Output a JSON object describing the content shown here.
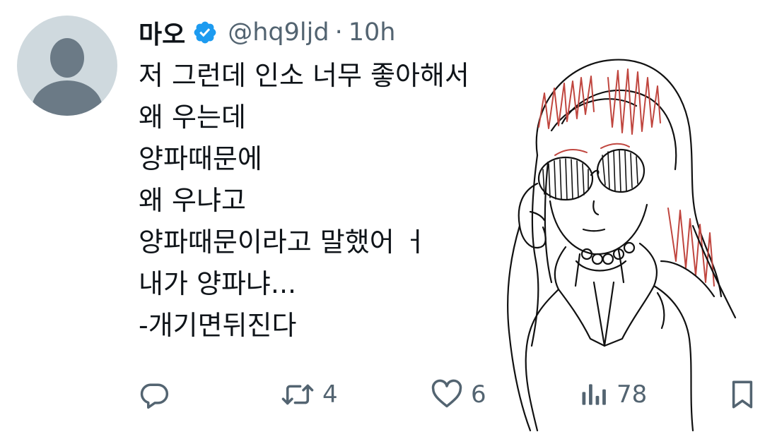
{
  "tweet": {
    "author_name": "마오",
    "verified": true,
    "handle": "@hq9ljd",
    "separator": "·",
    "time": "10h",
    "lines": [
      "저 그런데 인소 너무 좋아해서",
      "왜 우는데",
      "양파때문에",
      "왜 우냐고",
      "양파때문이라고 말했어 ㅓ",
      "내가 양파냐...",
      "-개기면뒤진다"
    ]
  },
  "actions": {
    "reply_icon": "reply-icon",
    "retweet_icon": "retweet-icon",
    "retweet_count": "4",
    "like_icon": "heart-icon",
    "like_count": "6",
    "views_icon": "views-icon",
    "views_count": "78",
    "bookmark_icon": "bookmark-icon"
  },
  "colors": {
    "text": "#0f1419",
    "secondary": "#536471",
    "verified": "#1d9bf0",
    "avatar_bg": "#cfd9de",
    "avatar_fg": "#6b7a86",
    "sketch_red": "#c0463f"
  }
}
